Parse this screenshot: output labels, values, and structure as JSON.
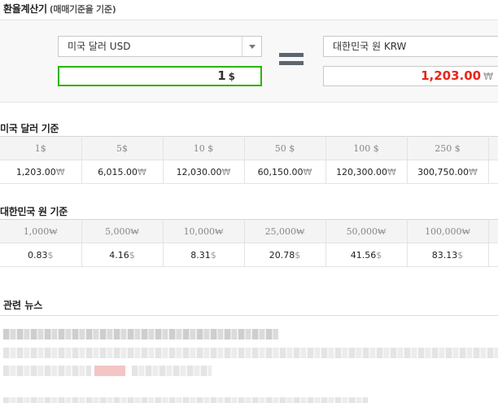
{
  "calculator": {
    "title": "환율계산기",
    "subtitle": "(매매기준율 기준)",
    "from_currency": "미국 달러 USD",
    "from_amount": "1",
    "from_unit": "$",
    "to_currency": "대한민국 원 KRW",
    "to_amount": "1,203.00",
    "to_unit": "₩",
    "accent_from": "#2db400",
    "accent_result": "#e8251b"
  },
  "usd_table": {
    "title": "미국 달러 기준",
    "headers": [
      "1$",
      "5$",
      "10 $",
      "50 $",
      "100 $",
      "250 $"
    ],
    "values": [
      {
        "num": "1,203.00",
        "unit": "₩"
      },
      {
        "num": "6,015.00",
        "unit": "₩"
      },
      {
        "num": "12,030.00",
        "unit": "₩"
      },
      {
        "num": "60,150.00",
        "unit": "₩"
      },
      {
        "num": "120,300.00",
        "unit": "₩"
      },
      {
        "num": "300,750.00",
        "unit": "₩"
      }
    ]
  },
  "krw_table": {
    "title": "대한민국 원 기준",
    "headers": [
      "1,000₩",
      "5,000₩",
      "10,000₩",
      "25,000₩",
      "50,000₩",
      "100,000₩"
    ],
    "values": [
      {
        "num": "0.83",
        "unit": "$"
      },
      {
        "num": "4.16",
        "unit": "$"
      },
      {
        "num": "8.31",
        "unit": "$"
      },
      {
        "num": "20.78",
        "unit": "$"
      },
      {
        "num": "41.56",
        "unit": "$"
      },
      {
        "num": "83.13",
        "unit": "$"
      }
    ]
  },
  "news": {
    "title": "관련 뉴스"
  }
}
